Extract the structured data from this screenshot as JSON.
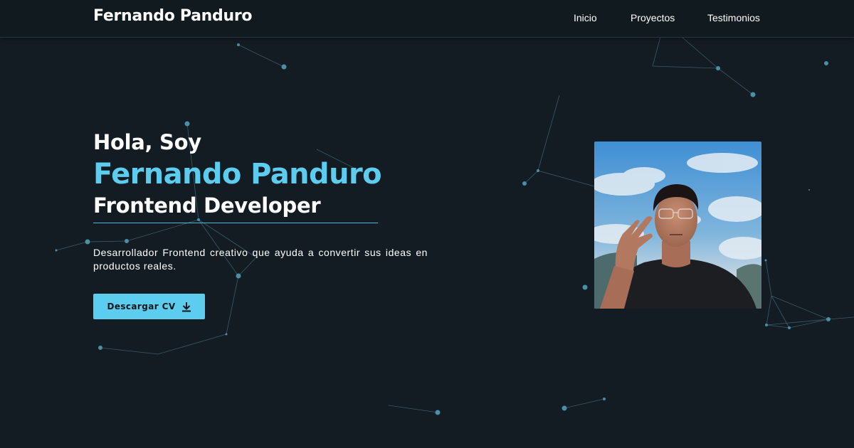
{
  "nav": {
    "brand": "Fernando Panduro",
    "links": [
      "Inicio",
      "Proyectos",
      "Testimonios"
    ]
  },
  "hero": {
    "greeting": "Hola, Soy",
    "name": "Fernando Panduro",
    "role": "Frontend Developer",
    "description": "Desarrollador Frontend creativo que ayuda a convertir sus ideas en productos reales.",
    "cv_button": "Descargar CV",
    "cv_icon": "download-icon"
  },
  "colors": {
    "background": "#131c22",
    "accent": "#5ccdee",
    "text": "#ffffff",
    "particle": "#4a8fa6"
  }
}
